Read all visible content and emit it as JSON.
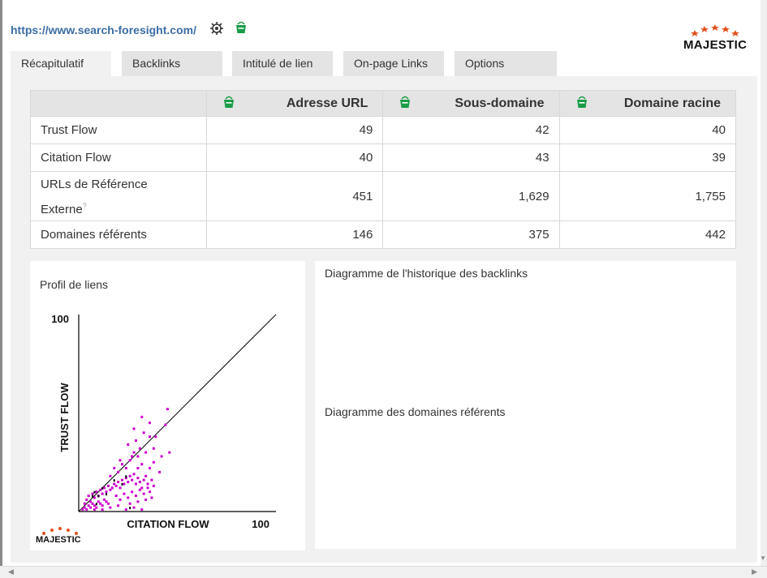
{
  "header": {
    "url": "https://www.search-foresight.com/",
    "logo_text": "MAJESTIC"
  },
  "tabs": [
    {
      "label": "Récapitulatif",
      "active": true
    },
    {
      "label": "Backlinks",
      "active": false
    },
    {
      "label": "Intitulé de lien",
      "active": false
    },
    {
      "label": "On-page Links",
      "active": false
    },
    {
      "label": "Options",
      "active": false
    }
  ],
  "metrics_table": {
    "columns": [
      "Adresse URL",
      "Sous-domaine",
      "Domaine racine"
    ],
    "rows": [
      {
        "label": "Trust Flow",
        "values": [
          "49",
          "42",
          "40"
        ]
      },
      {
        "label": "Citation Flow",
        "values": [
          "40",
          "43",
          "39"
        ]
      },
      {
        "label": "URLs de Référence Externe",
        "superscript": "?",
        "values": [
          "451",
          "1,629",
          "1,755"
        ]
      },
      {
        "label": "Domaines référents",
        "values": [
          "146",
          "375",
          "442"
        ]
      }
    ]
  },
  "link_profile": {
    "title": "Profil de liens",
    "logo_text": "MAJESTIC"
  },
  "backlink_history": {
    "title": "Diagramme de l'historique des backlinks"
  },
  "referring_domains": {
    "title": "Diagramme des domaines référents"
  },
  "chart_data": {
    "type": "scatter",
    "title": "",
    "xlabel": "CITATION FLOW",
    "ylabel": "TRUST FLOW",
    "xlim": [
      0,
      100
    ],
    "ylim": [
      0,
      100
    ],
    "x_tick_labels": [
      "100"
    ],
    "y_tick_labels": [
      "100"
    ],
    "grid": false,
    "reference_line": "diagonal",
    "color": "#cc00cc",
    "points": [
      [
        2,
        1
      ],
      [
        3,
        2
      ],
      [
        4,
        1
      ],
      [
        5,
        3
      ],
      [
        6,
        2
      ],
      [
        7,
        4
      ],
      [
        8,
        3
      ],
      [
        9,
        2
      ],
      [
        10,
        5
      ],
      [
        11,
        4
      ],
      [
        12,
        3
      ],
      [
        13,
        6
      ],
      [
        14,
        5
      ],
      [
        15,
        4
      ],
      [
        3,
        4
      ],
      [
        4,
        6
      ],
      [
        5,
        8
      ],
      [
        6,
        5
      ],
      [
        7,
        9
      ],
      [
        8,
        7
      ],
      [
        9,
        10
      ],
      [
        10,
        8
      ],
      [
        11,
        11
      ],
      [
        12,
        9
      ],
      [
        13,
        12
      ],
      [
        14,
        10
      ],
      [
        15,
        13
      ],
      [
        16,
        11
      ],
      [
        17,
        12
      ],
      [
        18,
        14
      ],
      [
        19,
        13
      ],
      [
        20,
        15
      ],
      [
        21,
        12
      ],
      [
        22,
        16
      ],
      [
        23,
        14
      ],
      [
        24,
        17
      ],
      [
        25,
        15
      ],
      [
        26,
        18
      ],
      [
        27,
        16
      ],
      [
        28,
        19
      ],
      [
        29,
        14
      ],
      [
        30,
        17
      ],
      [
        31,
        15
      ],
      [
        32,
        12
      ],
      [
        33,
        16
      ],
      [
        34,
        18
      ],
      [
        35,
        14
      ],
      [
        36,
        10
      ],
      [
        37,
        16
      ],
      [
        38,
        13
      ],
      [
        20,
        20
      ],
      [
        22,
        24
      ],
      [
        24,
        22
      ],
      [
        26,
        26
      ],
      [
        28,
        30
      ],
      [
        30,
        28
      ],
      [
        32,
        24
      ],
      [
        34,
        30
      ],
      [
        36,
        22
      ],
      [
        38,
        32
      ],
      [
        16,
        18
      ],
      [
        18,
        22
      ],
      [
        21,
        26
      ],
      [
        25,
        34
      ],
      [
        29,
        36
      ],
      [
        33,
        40
      ],
      [
        36,
        38
      ],
      [
        39,
        38
      ],
      [
        31,
        32
      ],
      [
        27,
        28
      ],
      [
        19,
        8
      ],
      [
        21,
        6
      ],
      [
        23,
        9
      ],
      [
        25,
        7
      ],
      [
        27,
        10
      ],
      [
        29,
        8
      ],
      [
        31,
        11
      ],
      [
        33,
        9
      ],
      [
        35,
        12
      ],
      [
        37,
        7
      ],
      [
        24,
        1
      ],
      [
        28,
        2
      ],
      [
        32,
        1
      ],
      [
        20,
        3
      ],
      [
        16,
        2
      ],
      [
        12,
        1
      ],
      [
        8,
        1
      ],
      [
        26,
        4
      ],
      [
        30,
        5
      ],
      [
        34,
        6
      ],
      [
        45,
        52
      ],
      [
        32,
        48
      ],
      [
        36,
        45
      ],
      [
        28,
        42
      ],
      [
        44,
        44
      ],
      [
        46,
        30
      ],
      [
        41,
        20
      ],
      [
        38,
        25
      ],
      [
        30,
        22
      ],
      [
        42,
        28
      ]
    ],
    "black_points": [
      [
        8,
        10
      ],
      [
        10,
        8
      ],
      [
        12,
        12
      ],
      [
        14,
        9
      ],
      [
        18,
        16
      ],
      [
        22,
        14
      ],
      [
        24,
        18
      ],
      [
        26,
        2
      ],
      [
        9,
        4
      ],
      [
        7,
        8
      ]
    ]
  }
}
